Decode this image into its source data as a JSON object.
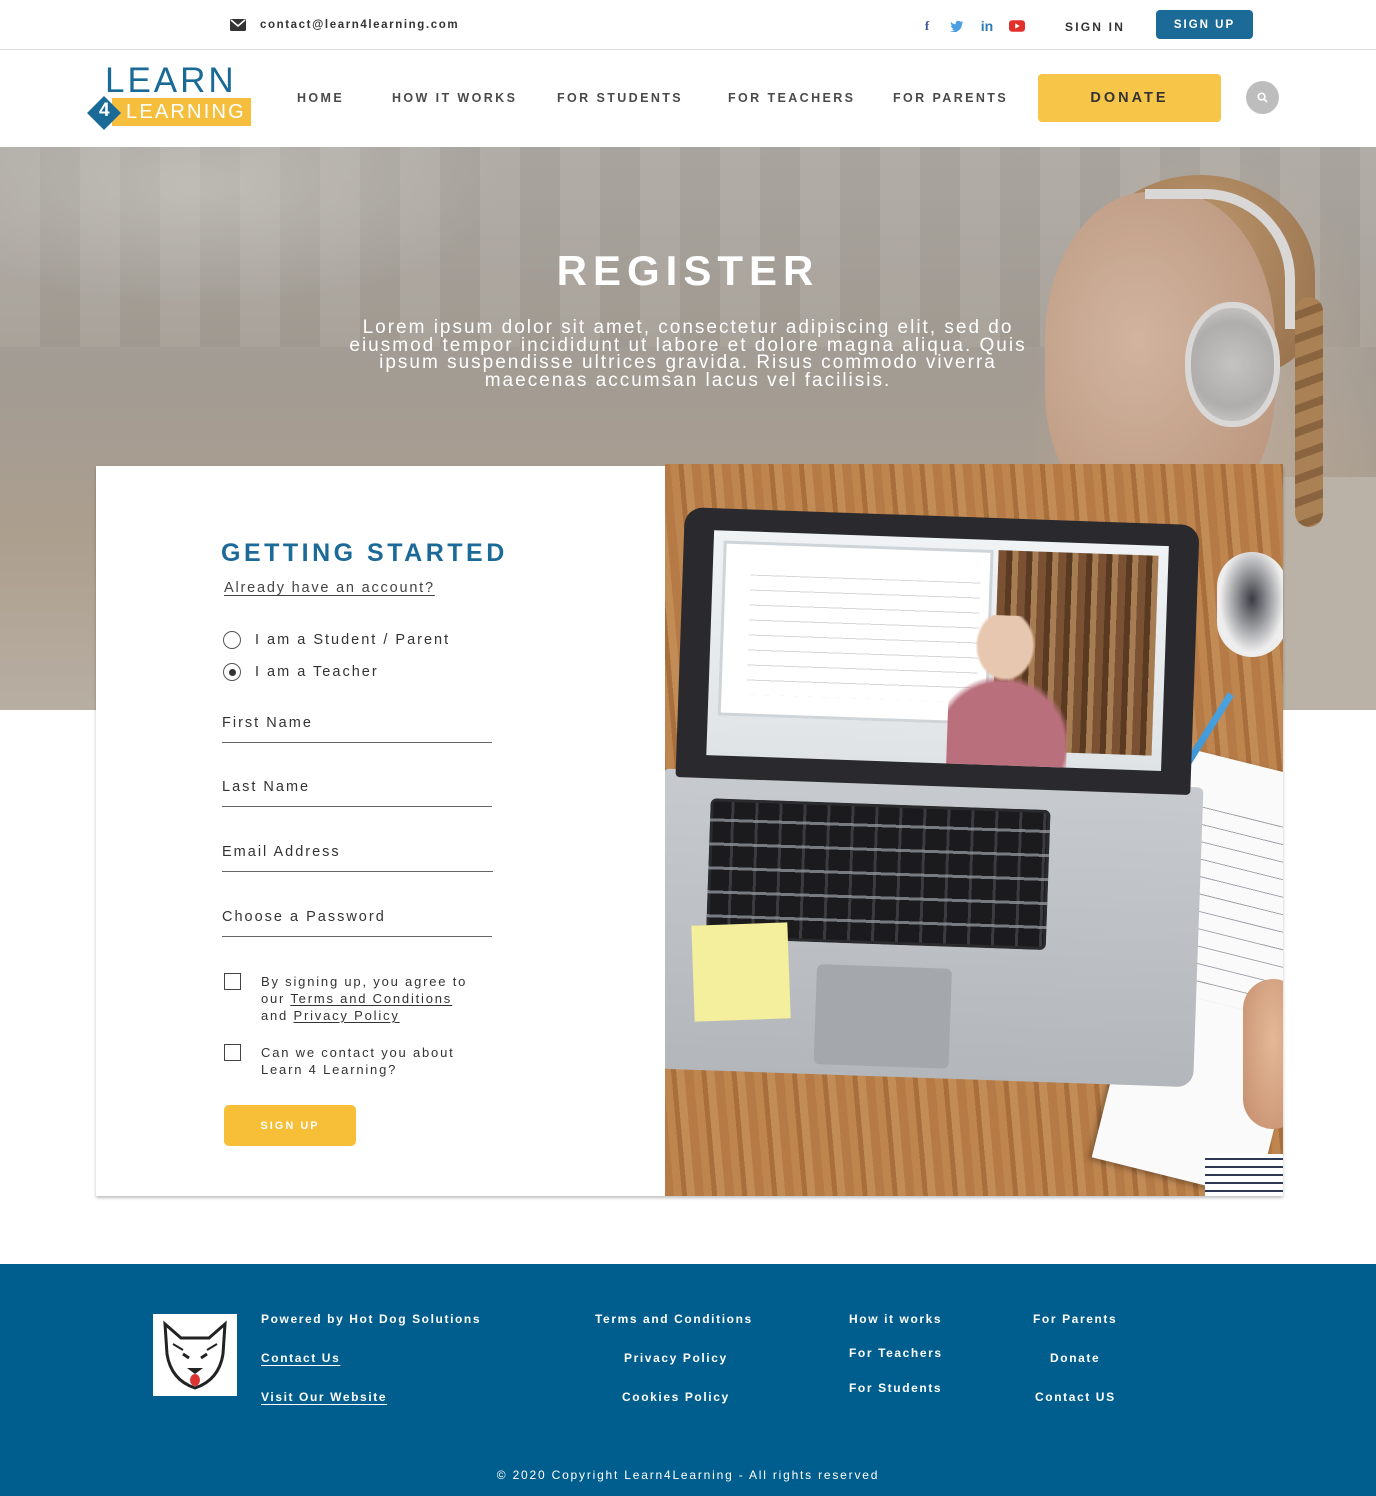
{
  "topbar": {
    "email": "contact@learn4learning.com",
    "socials": [
      "facebook-icon",
      "twitter-icon",
      "linkedin-icon",
      "youtube-icon"
    ],
    "sign_in": "SIGN IN",
    "sign_up": "SIGN UP"
  },
  "logo": {
    "line1": "LEARN",
    "number": "4",
    "line2": "LEARNING"
  },
  "nav": {
    "items": [
      "HOME",
      "HOW IT WORKS",
      "FOR STUDENTS",
      "FOR TEACHERS",
      "FOR PARENTS"
    ],
    "donate": "DONATE"
  },
  "hero": {
    "title": "REGISTER",
    "text": "Lorem ipsum dolor sit amet, consectetur adipiscing elit, sed do eiusmod tempor incididunt ut labore et dolore magna aliqua. Quis ipsum suspendisse ultrices gravida. Risus commodo viverra maecenas accumsan lacus vel facilisis."
  },
  "form": {
    "heading": "GETTING STARTED",
    "already": "Already have an account?",
    "role_options": [
      "I am a Student / Parent",
      "I am a Teacher"
    ],
    "selected_role": "I am a Teacher",
    "fields": {
      "first_name": "First Name",
      "last_name": "Last Name",
      "email": "Email Address",
      "password": "Choose a Password"
    },
    "agree": {
      "pre": "By signing up, you agree to",
      "our": "our ",
      "terms": "Terms and Conditions",
      "and": "and ",
      "privacy": "Privacy Policy"
    },
    "contact": {
      "line1": "Can we contact you about",
      "line2": "Learn 4 Learning?"
    },
    "submit": "SIGN UP"
  },
  "footer": {
    "col1": [
      "Powered by Hot Dog Solutions",
      "Contact Us",
      "Visit Our Website"
    ],
    "col2": [
      "Terms and Conditions",
      "Privacy Policy",
      "Cookies Policy"
    ],
    "col3": [
      "How it works",
      "For Teachers",
      "For Students"
    ],
    "col4": [
      "For Parents",
      "Donate",
      "Contact US"
    ],
    "copyright": "© 2020 Copyright Learn4Learning - All rights reserved"
  },
  "colors": {
    "brand_blue": "#1c6a98",
    "accent_yellow": "#f7c548",
    "footer_blue": "#005e8e"
  }
}
